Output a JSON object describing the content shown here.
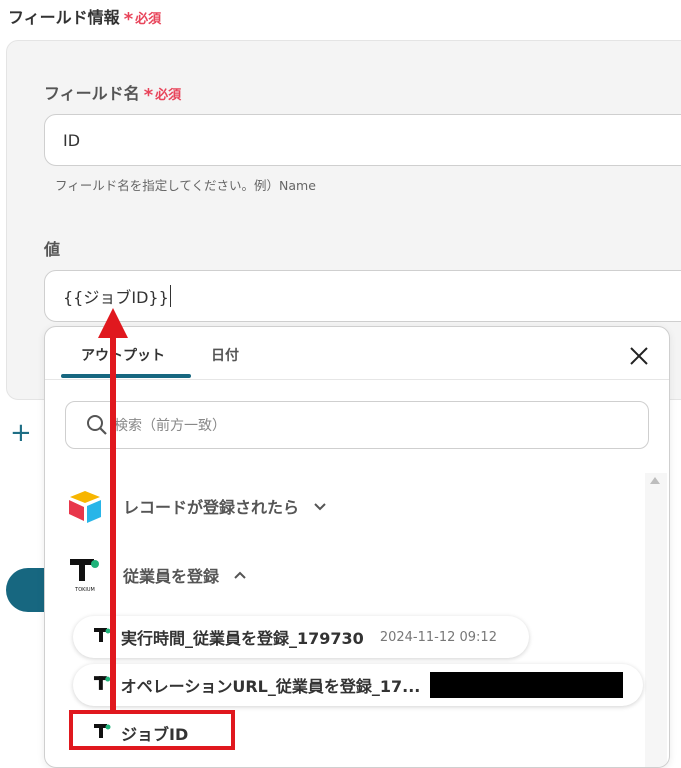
{
  "section": {
    "title": "フィールド情報",
    "required": "必須"
  },
  "field_name": {
    "label": "フィールド名",
    "required": "必須",
    "value": "ID",
    "hint": "フィールド名を指定してください。例）Name"
  },
  "value_field": {
    "label": "値",
    "value": "{{ジョブID}}"
  },
  "dropdown": {
    "tabs": [
      {
        "label": "アウトプット",
        "active": true
      },
      {
        "label": "日付",
        "active": false
      }
    ],
    "search_placeholder": "検索（前方一致）",
    "groups": [
      {
        "title": "レコードが登録されたら",
        "expanded": false,
        "icon": "airtable-logo-icon"
      },
      {
        "title": "従業員を登録",
        "expanded": true,
        "icon": "tokium-logo-icon"
      }
    ],
    "items": [
      {
        "label": "実行時間_従業員を登録_179730",
        "value": "2024-11-12 09:12"
      },
      {
        "label": "オペレーションURL_従業員を登録_17...",
        "value": ""
      },
      {
        "label": "ジョブID",
        "value": ""
      }
    ],
    "logo_text": "TOKIUM"
  },
  "colors": {
    "accent": "#176780",
    "required": "#e8445a",
    "annotation": "#e0181e"
  }
}
